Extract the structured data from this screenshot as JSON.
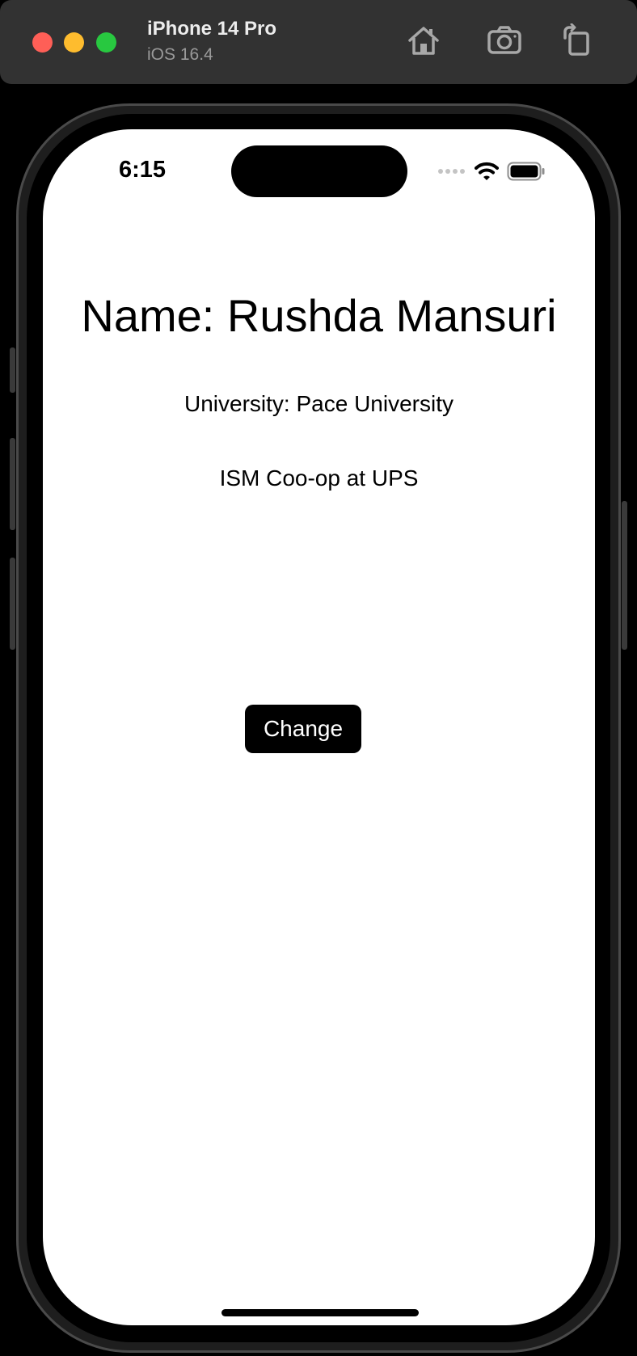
{
  "titlebar": {
    "device_name": "iPhone 14 Pro",
    "os_version": "iOS 16.4",
    "buttons": [
      {
        "name": "home-button",
        "icon": "home-icon"
      },
      {
        "name": "screenshot-button",
        "icon": "camera-icon"
      },
      {
        "name": "rotate-button",
        "icon": "rotate-icon"
      }
    ]
  },
  "status_bar": {
    "time": "6:15",
    "icons": [
      "signal-dots-icon",
      "wifi-icon",
      "battery-icon"
    ]
  },
  "content": {
    "name_label": "Name: Rushda Mansuri",
    "university_label": "University: Pace University",
    "role_label": "ISM Coo-op at UPS",
    "change_button_label": "Change"
  },
  "colors": {
    "titlebar_bg": "#323232",
    "close": "#fe5f57",
    "minimize": "#febc2e",
    "maximize": "#28c840",
    "screen_bg": "#ffffff",
    "button_bg": "#000000",
    "button_text": "#ffffff"
  }
}
